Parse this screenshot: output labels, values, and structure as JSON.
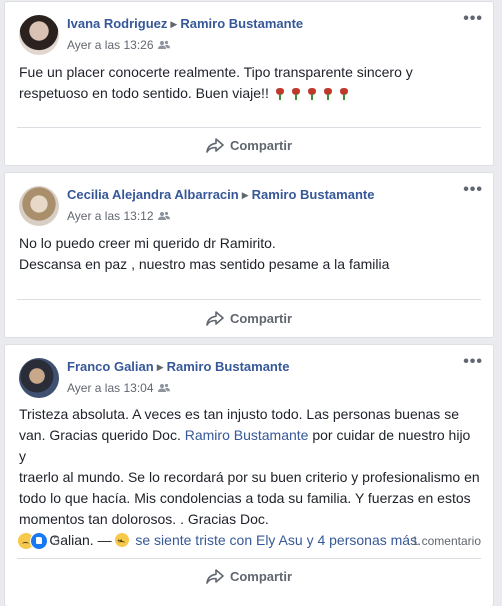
{
  "posts": [
    {
      "author": "Ivana Rodriguez",
      "recipient": "Ramiro Bustamante",
      "timestamp": "Ayer a las 13:26",
      "privacy_icon": "friends-icon",
      "body_lines": [
        "Fue un placer conocerte realmente. Tipo transparente sincero y",
        "respetuoso en todo sentido. Buen viaje!!"
      ],
      "trailing_emoji": "rose-icon x5",
      "share_label": "Compartir"
    },
    {
      "author": "Cecilia Alejandra Albarracin",
      "recipient": "Ramiro Bustamante",
      "timestamp": "Ayer a las 13:12",
      "privacy_icon": "friends-icon",
      "body_lines": [
        "No lo puedo creer mi querido dr Ramirito.",
        "Descansa en paz , nuestro mas sentido pesame a la familia"
      ],
      "share_label": "Compartir"
    },
    {
      "author": "Franco Galian",
      "recipient": "Ramiro Bustamante",
      "timestamp": "Ayer a las 13:04",
      "privacy_icon": "friends-icon",
      "body_lines": [
        "Tristeza absoluta. A veces es tan injusto todo. Las personas buenas se",
        "van. Gracias querido Doc.",
        "Ramiro Bustamante",
        "por cuidar de nuestro hijo y",
        "traerlo al mundo. Se lo recordará por su buen criterio y profesionalismo en",
        "todo lo que hacía. Mis condolencias a toda su familia. Y fuerzas en estos",
        "momentos tan dolorosos. . Gracias Doc.",
        "Flia. Galian. —",
        "se siente triste con Ely Asu y 4 personas más."
      ],
      "reaction_count": "3",
      "comments": "1 comentario",
      "share_label": "Compartir"
    }
  ],
  "colors": {
    "link": "#365899",
    "page_bg": "#e9ebee",
    "secondary_text": "#606770"
  }
}
